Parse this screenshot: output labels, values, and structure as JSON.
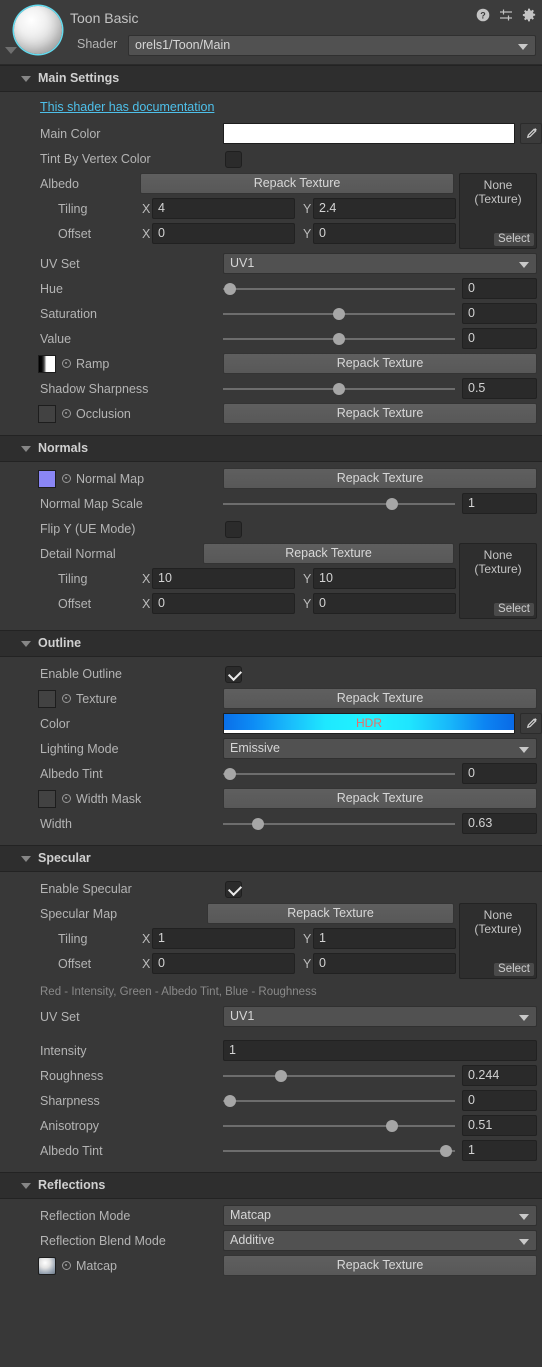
{
  "header": {
    "title": "Toon Basic",
    "shader_label": "Shader",
    "shader_value": "orels1/Toon/Main",
    "icons": [
      "help-icon",
      "preset-icon",
      "gear-icon"
    ]
  },
  "common": {
    "repack": "Repack Texture",
    "none_line1": "None",
    "none_line2": "(Texture)",
    "select": "Select",
    "x": "X",
    "y": "Y",
    "tiling": "Tiling",
    "offset": "Offset",
    "uv_set": "UV Set",
    "hdr": "HDR"
  },
  "sections": [
    {
      "name": "Main Settings"
    },
    {
      "name": "Normals"
    },
    {
      "name": "Outline"
    },
    {
      "name": "Specular"
    },
    {
      "name": "Reflections"
    }
  ],
  "main": {
    "doc_link": "This shader has documentation",
    "main_color_label": "Main Color",
    "main_color_value": "#ffffff",
    "tint_vertex_label": "Tint By Vertex Color",
    "tint_vertex_checked": false,
    "albedo_label": "Albedo",
    "albedo_tiling_x": "4",
    "albedo_tiling_y": "2.4",
    "albedo_offset_x": "0",
    "albedo_offset_y": "0",
    "uv_set_value": "UV1",
    "hue_label": "Hue",
    "hue_value": "0",
    "hue_pct": 3,
    "saturation_label": "Saturation",
    "saturation_value": "0",
    "saturation_pct": 50,
    "value_label": "Value",
    "value_value": "0",
    "value_pct": 50,
    "ramp_label": "Ramp",
    "shadow_sharpness_label": "Shadow Sharpness",
    "shadow_sharpness_value": "0.5",
    "shadow_sharpness_pct": 50,
    "occlusion_label": "Occlusion"
  },
  "normals": {
    "normal_map_label": "Normal Map",
    "normal_map_swatch": "#8a86f5",
    "scale_label": "Normal Map Scale",
    "scale_value": "1",
    "scale_pct": 73,
    "flip_y_label": "Flip Y (UE Mode)",
    "flip_y_checked": false,
    "detail_normal_label": "Detail Normal",
    "detail_tiling_x": "10",
    "detail_tiling_y": "10",
    "detail_offset_x": "0",
    "detail_offset_y": "0"
  },
  "outline": {
    "enable_label": "Enable Outline",
    "enable_checked": true,
    "texture_label": "Texture",
    "color_label": "Color",
    "lighting_mode_label": "Lighting Mode",
    "lighting_mode_value": "Emissive",
    "albedo_tint_label": "Albedo Tint",
    "albedo_tint_value": "0",
    "albedo_tint_pct": 3,
    "width_mask_label": "Width Mask",
    "width_label": "Width",
    "width_value": "0.63",
    "width_pct": 15
  },
  "specular": {
    "enable_label": "Enable Specular",
    "enable_checked": true,
    "map_label": "Specular Map",
    "tiling_x": "1",
    "tiling_y": "1",
    "offset_x": "0",
    "offset_y": "0",
    "channel_hint": "Red - Intensity, Green - Albedo Tint, Blue - Roughness",
    "uv_set_value": "UV1",
    "intensity_label": "Intensity",
    "intensity_value": "1",
    "roughness_label": "Roughness",
    "roughness_value": "0.244",
    "roughness_pct": 25,
    "sharpness_label": "Sharpness",
    "sharpness_value": "0",
    "sharpness_pct": 3,
    "anisotropy_label": "Anisotropy",
    "anisotropy_value": "0.51",
    "anisotropy_pct": 73,
    "albedo_tint_label": "Albedo Tint",
    "albedo_tint_value": "1",
    "albedo_tint_pct": 96
  },
  "reflections": {
    "mode_label": "Reflection Mode",
    "mode_value": "Matcap",
    "blend_label": "Reflection Blend Mode",
    "blend_value": "Additive",
    "matcap_label": "Matcap"
  }
}
